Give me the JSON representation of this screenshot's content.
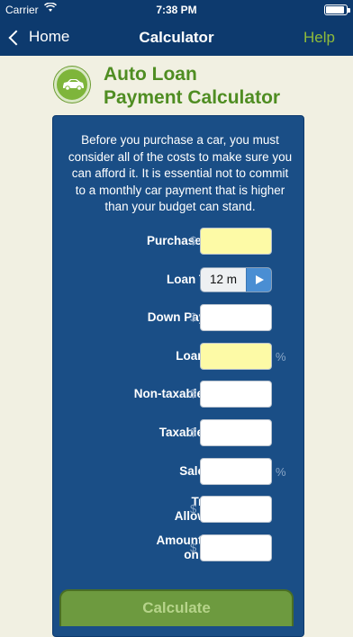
{
  "status_bar": {
    "carrier": "Carrier",
    "time": "7:38 PM"
  },
  "nav": {
    "back_label": "Home",
    "title": "Calculator",
    "help_label": "Help"
  },
  "header": {
    "icon": "car-icon",
    "title_line1": "Auto Loan",
    "title_line2": "Payment Calculator"
  },
  "intro": "Before you purchase a car, you must consider all of the costs to make sure you can afford it. It is essential not to commit to a monthly car payment that is higher than your budget can stand.",
  "form": {
    "purchase_price_label": "Purchase Price:",
    "loan_terms_label": "Loan Terms:",
    "loan_terms_value": "12 m",
    "down_payment_label": "Down Payment:",
    "loan_rate_label": "Loan Rate:",
    "non_taxable_fees_label": "Non-taxable Fees:",
    "taxable_fees_label": "Taxable Fees:",
    "sales_tax_label": "Sales Tax:",
    "trade_in_line1": "Trade-in",
    "trade_in_line2": "Allowance:",
    "owed_line1": "Amount Owed",
    "owed_line2": "on Trade:",
    "dollar_sign": "$",
    "percent_sign": "%"
  },
  "calculate_label": "Calculate",
  "colors": {
    "nav_bg": "#0d3a6e",
    "panel_bg": "#1a4e86",
    "accent_green": "#7eb53b",
    "required_field": "#fdfaa6"
  }
}
